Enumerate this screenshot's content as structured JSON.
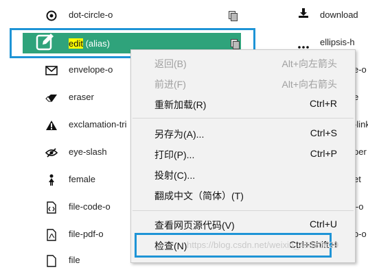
{
  "left_list": [
    {
      "icon": "dot-circle-icon",
      "label": "dot-circle-o"
    },
    {
      "icon": "pencil-square-icon",
      "label": "edit (alias)"
    },
    {
      "icon": "envelope-o-icon",
      "label": "envelope-o"
    },
    {
      "icon": "eraser-icon",
      "label": "eraser"
    },
    {
      "icon": "exclamation-triangle-icon",
      "label": "exclamation-tri"
    },
    {
      "icon": "eye-slash-icon",
      "label": "eye-slash"
    },
    {
      "icon": "female-icon",
      "label": "female"
    },
    {
      "icon": "file-code-o-icon",
      "label": "file-code-o"
    },
    {
      "icon": "file-pdf-o-icon",
      "label": "file-pdf-o"
    },
    {
      "icon": "file-icon",
      "label": "file"
    }
  ],
  "selected": {
    "highlight": "edit",
    "rest": " (alias)"
  },
  "right_list": [
    {
      "icon": "download-icon",
      "label": "download"
    },
    {
      "icon": "ellipsis-h-icon",
      "label": "ellipsis-h"
    },
    {
      "label": "e-o"
    },
    {
      "label": "e"
    },
    {
      "label": "-link"
    },
    {
      "label": "per"
    },
    {
      "label": "et"
    },
    {
      "label": "l-o"
    },
    {
      "label": "o-o"
    }
  ],
  "context_menu": {
    "items": [
      {
        "label": "返回(B)",
        "shortcut": "Alt+向左箭头",
        "disabled": true
      },
      {
        "label": "前进(F)",
        "shortcut": "Alt+向右箭头",
        "disabled": true
      },
      {
        "label": "重新加载(R)",
        "shortcut": "Ctrl+R",
        "disabled": false
      },
      {
        "label": "另存为(A)...",
        "shortcut": "Ctrl+S",
        "disabled": false
      },
      {
        "label": "打印(P)...",
        "shortcut": "Ctrl+P",
        "disabled": false
      },
      {
        "label": "投射(C)...",
        "shortcut": "",
        "disabled": false
      },
      {
        "label": "翻成中文（简体）(T)",
        "shortcut": "",
        "disabled": false
      },
      {
        "label": "查看网页源代码(V)",
        "shortcut": "Ctrl+U",
        "disabled": false
      },
      {
        "label": "检查(N)",
        "shortcut": "Ctrl+Shift+I",
        "disabled": false
      }
    ]
  },
  "watermark": "https://blog.csdn.net/weixin_43883629",
  "colors": {
    "accent_border": "#1e94d6",
    "selected_bg": "#2fa37b",
    "highlight": "#ffff00"
  }
}
